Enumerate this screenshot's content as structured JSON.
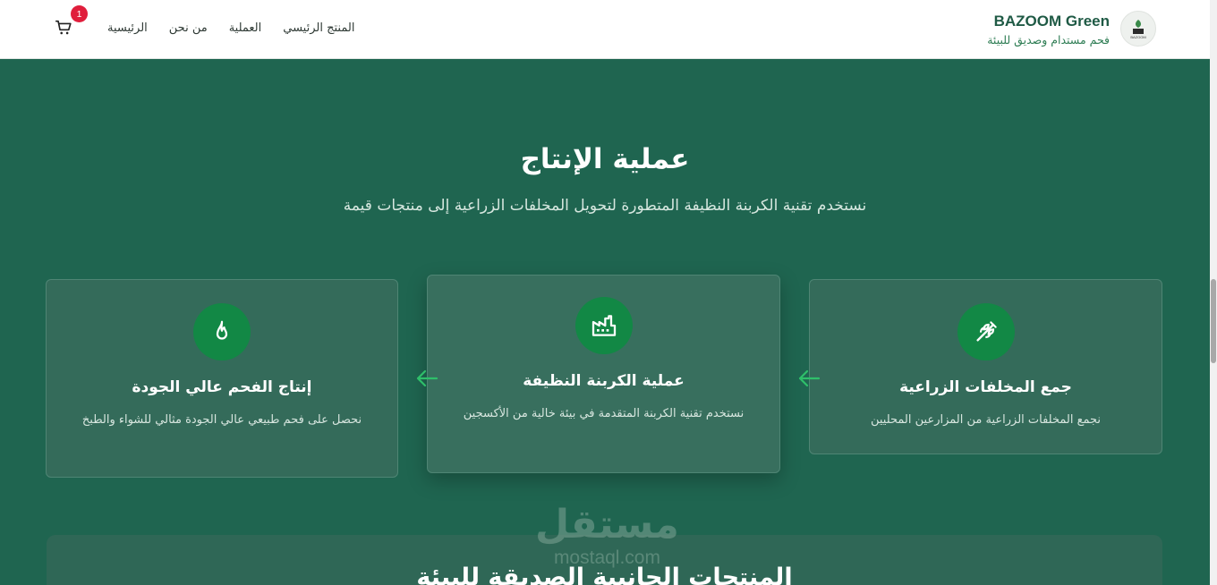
{
  "header": {
    "brand_name": "BAZOOM Green",
    "brand_tagline": "فحم مستدام وصديق للبيئة",
    "nav": [
      "الرئيسية",
      "من نحن",
      "العملية",
      "المنتج الرئيسي"
    ],
    "cart_count": "1"
  },
  "section": {
    "title": "عملية الإنتاج",
    "subtitle": "نستخدم تقنية الكربنة النظيفة المتطورة لتحويل المخلفات الزراعية إلى منتجات قيمة",
    "steps": [
      {
        "title": "جمع المخلفات الزراعية",
        "description": "نجمع المخلفات الزراعية من المزارعين المحليين",
        "icon": "wheat-icon"
      },
      {
        "title": "عملية الكربنة النظيفة",
        "description": "نستخدم تقنية الكربنة المتقدمة في بيئة خالية من الأكسجين",
        "icon": "factory-icon"
      },
      {
        "title": "إنتاج الفحم عالي الجودة",
        "description": "نحصل على فحم طبيعي عالي الجودة مثالي للشواء والطبخ",
        "icon": "flame-icon"
      }
    ]
  },
  "products": {
    "title": "المنتجات الجانبية الصديقة للبيئة"
  },
  "watermark": {
    "arabic": "مستقل",
    "latin": "mostaql.com"
  },
  "colors": {
    "background": "#1f6550",
    "accent": "#128845",
    "arrow": "#2fbf6a",
    "badge": "#e01e3c"
  }
}
